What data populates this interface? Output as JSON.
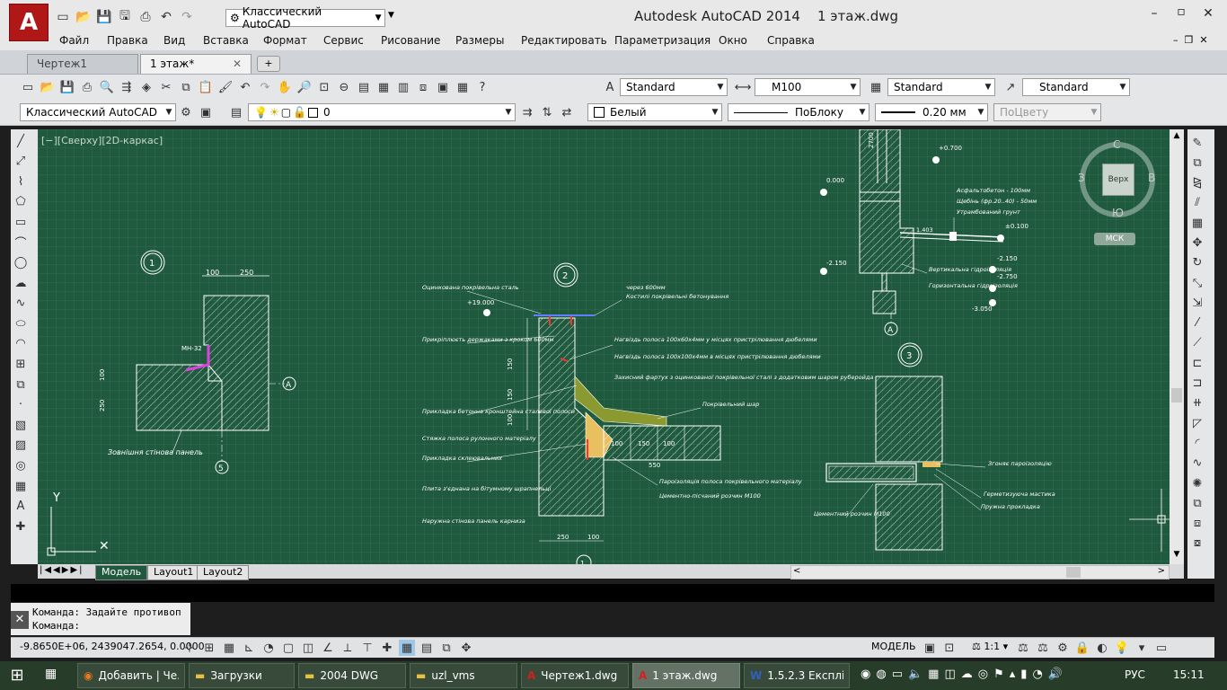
{
  "app": {
    "title": "Autodesk AutoCAD 2014",
    "document": "1 этаж.dwg",
    "logo_letter": "A",
    "workspace": "Классический AutoCAD"
  },
  "menu": [
    "Файл",
    "Правка",
    "Вид",
    "Вставка",
    "Формат",
    "Сервис",
    "Рисование",
    "Размеры",
    "Редактировать",
    "Параметризация",
    "Окно",
    "Справка"
  ],
  "doc_tabs": [
    {
      "label": "Чертеж1",
      "active": false
    },
    {
      "label": "1 этаж*",
      "active": true
    }
  ],
  "toolbar1": {
    "text_style": "Standard",
    "dim_style": "M100",
    "table_style": "Standard",
    "mleader_style": "Standard"
  },
  "toolbar2": {
    "workspace": "Классический AutoCAD",
    "layer": "0",
    "color": "Белый",
    "linetype": "ПоБлоку",
    "lineweight": "0.20 мм",
    "plotstyle": "ПоЦвету"
  },
  "viewport": {
    "label": "[−][Сверху][2D-каркас]",
    "viewcube": {
      "top": "Верх",
      "n": "С",
      "s": "Ю",
      "e": "В",
      "w": "З",
      "ucs": "МСК"
    }
  },
  "drawing": {
    "detail1": {
      "marker": "1",
      "dims": [
        "100",
        "250"
      ],
      "label": "Зовнішня стінова панель",
      "axes": [
        "А",
        "5"
      ],
      "note": "МН-32",
      "side_dims": [
        "100",
        "250"
      ]
    },
    "detail2": {
      "marker": "2",
      "axis": "1",
      "left_notes": [
        "Оцинкована покрівельна сталь",
        "Прикріплюєть держаками з кроком 600мм",
        "Прикладка бетонна кронштейна сталевої полоси",
        "Стяжка полоса рулонного матеріалу",
        "Прикладка склеювальних",
        "Плита з'єднана на бітумному шрапнельці",
        "Наружна стінова панель карниза"
      ],
      "right_notes": [
        "через 600мм",
        "Костилі покрівельні бетонування",
        "Нагвіздь полоса 100х60х4мм у місцях пристрілювання дюбелями",
        "Нагвіздь полоса 100х100х4мм в місцях пристрілювання дюбелями",
        "Захисний фартух з оцинкованої покрівельної сталі з додатковим шаром руберойда",
        "Покрівельний шар",
        "Пароізоляція полоса покрівельного матеріалу",
        "Цементно-пісчаний розчин М100"
      ],
      "level": "+19.000",
      "dims": [
        "550",
        "250",
        "100",
        "100",
        "150",
        "100",
        "150",
        "150",
        "100"
      ]
    },
    "detail3": {
      "levels": [
        "+0.700",
        "0.000",
        "±0.100",
        "-2.150",
        "-2.150",
        "-2.750",
        "-3.050",
        "1.403"
      ],
      "notes": [
        "Асфальтобетон - 100мм",
        "Щебінь (фр.20..40) - 50мм",
        "Утрамбований грунт",
        "Вертикальна гідроізоляція",
        "Горизонтальна гідроізоляція"
      ],
      "axis": "А",
      "top_dim": "2700"
    },
    "detail4": {
      "marker": "3",
      "notes": [
        "Згоняє пароізоляцію",
        "Гермети­зуюча мастика",
        "Пружна прокладка",
        "Цементний розчин М100"
      ]
    }
  },
  "layout_tabs": [
    "Модель",
    "Layout1",
    "Layout2"
  ],
  "command": {
    "line1": "Команда: Задайте противоп",
    "line2": "Команда:"
  },
  "status": {
    "coords": "-9.8650E+06, 2439047.2654, 0.0000",
    "space": "МОДЕЛЬ",
    "scale": "1:1"
  },
  "taskbar": [
    {
      "label": "Добавить | Че...",
      "icon": "firefox-icon",
      "active": false
    },
    {
      "label": "Загрузки",
      "icon": "folder-icon",
      "active": false
    },
    {
      "label": "2004 DWG",
      "icon": "folder-icon",
      "active": false
    },
    {
      "label": "uzl_vms",
      "icon": "folder-icon",
      "active": false
    },
    {
      "label": "Чертеж1.dwg",
      "icon": "autocad-icon",
      "active": false
    },
    {
      "label": "1 этаж.dwg",
      "icon": "autocad-icon",
      "active": true
    },
    {
      "label": "1.5.2.3 Експлі...",
      "icon": "word-icon",
      "active": false
    }
  ],
  "tray": {
    "lang": "РУС",
    "time": "15:11"
  },
  "colors": {
    "canvas": "#1f5a3e",
    "lines": "#ffffff",
    "taskbar": "#283c2a",
    "accent": "#b01818"
  }
}
